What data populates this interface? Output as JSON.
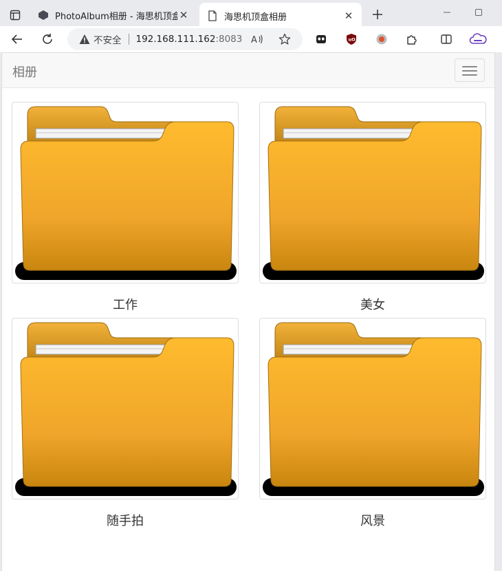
{
  "browser": {
    "tabs": [
      {
        "title": "PhotoAlbum相册 - 海思机顶盒N",
        "favicon": "cube-icon",
        "active": false
      },
      {
        "title": "海思机顶盒相册",
        "favicon": "page-icon",
        "active": true
      }
    ],
    "address": {
      "security_label": "不安全",
      "host": "192.168.111.162",
      "port": ":8083"
    }
  },
  "navbar": {
    "brand": "相册"
  },
  "albums": [
    {
      "name": "工作",
      "icon": "folder-icon"
    },
    {
      "name": "美女",
      "icon": "folder-icon"
    },
    {
      "name": "随手拍",
      "icon": "folder-icon"
    },
    {
      "name": "风景",
      "icon": "folder-icon"
    }
  ],
  "colors": {
    "folder_top": "#ffbb2e",
    "folder_bottom": "#c9860f",
    "folder_back": "#d6960f",
    "navbar_bg": "#f8f8f8"
  }
}
